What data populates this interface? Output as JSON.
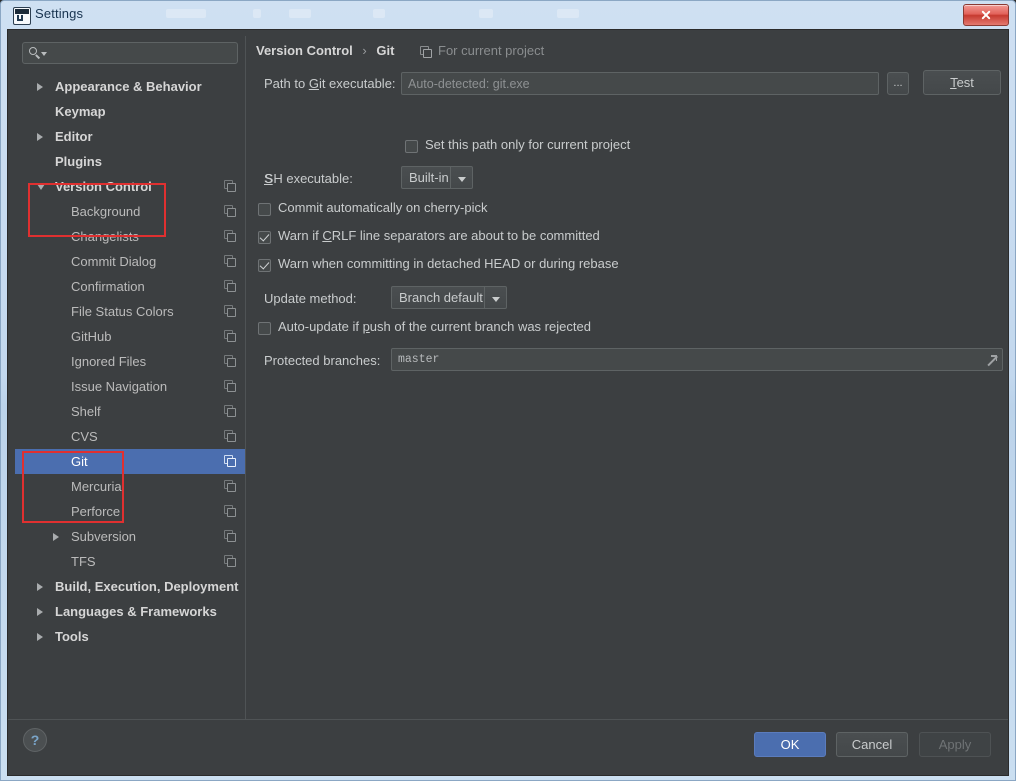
{
  "window": {
    "title": "Settings",
    "app_icon": "intellij-idea-icon",
    "close_label": "Close"
  },
  "search": {
    "value": "",
    "placeholder": "",
    "icon": "search-icon",
    "dropdown_icon": "chevron-down-icon"
  },
  "sidebar": {
    "items": [
      {
        "label": "Appearance & Behavior",
        "indent": 40,
        "arrow": "closed",
        "bold": true,
        "scope_icon": false,
        "selected": false
      },
      {
        "label": "Keymap",
        "indent": 40,
        "arrow": "none",
        "bold": true,
        "scope_icon": false,
        "selected": false
      },
      {
        "label": "Editor",
        "indent": 40,
        "arrow": "closed",
        "bold": true,
        "scope_icon": false,
        "selected": false
      },
      {
        "label": "Plugins",
        "indent": 40,
        "arrow": "none",
        "bold": true,
        "scope_icon": false,
        "selected": false
      },
      {
        "label": "Version Control",
        "indent": 40,
        "arrow": "open",
        "bold": true,
        "scope_icon": true,
        "selected": false
      },
      {
        "label": "Background",
        "indent": 56,
        "arrow": "none",
        "bold": false,
        "scope_icon": true,
        "selected": false
      },
      {
        "label": "Changelists",
        "indent": 56,
        "arrow": "none",
        "bold": false,
        "scope_icon": true,
        "selected": false
      },
      {
        "label": "Commit Dialog",
        "indent": 56,
        "arrow": "none",
        "bold": false,
        "scope_icon": true,
        "selected": false
      },
      {
        "label": "Confirmation",
        "indent": 56,
        "arrow": "none",
        "bold": false,
        "scope_icon": true,
        "selected": false
      },
      {
        "label": "File Status Colors",
        "indent": 56,
        "arrow": "none",
        "bold": false,
        "scope_icon": true,
        "selected": false
      },
      {
        "label": "GitHub",
        "indent": 56,
        "arrow": "none",
        "bold": false,
        "scope_icon": true,
        "selected": false
      },
      {
        "label": "Ignored Files",
        "indent": 56,
        "arrow": "none",
        "bold": false,
        "scope_icon": true,
        "selected": false
      },
      {
        "label": "Issue Navigation",
        "indent": 56,
        "arrow": "none",
        "bold": false,
        "scope_icon": true,
        "selected": false
      },
      {
        "label": "Shelf",
        "indent": 56,
        "arrow": "none",
        "bold": false,
        "scope_icon": true,
        "selected": false
      },
      {
        "label": "CVS",
        "indent": 56,
        "arrow": "none",
        "bold": false,
        "scope_icon": true,
        "selected": false
      },
      {
        "label": "Git",
        "indent": 56,
        "arrow": "none",
        "bold": false,
        "scope_icon": true,
        "selected": true
      },
      {
        "label": "Mercurial",
        "indent": 56,
        "arrow": "none",
        "bold": false,
        "scope_icon": true,
        "selected": false
      },
      {
        "label": "Perforce",
        "indent": 56,
        "arrow": "none",
        "bold": false,
        "scope_icon": true,
        "selected": false
      },
      {
        "label": "Subversion",
        "indent": 56,
        "arrow": "closed",
        "bold": false,
        "scope_icon": true,
        "selected": false
      },
      {
        "label": "TFS",
        "indent": 56,
        "arrow": "none",
        "bold": false,
        "scope_icon": true,
        "selected": false
      },
      {
        "label": "Build, Execution, Deployment",
        "indent": 40,
        "arrow": "closed",
        "bold": true,
        "scope_icon": false,
        "selected": false
      },
      {
        "label": "Languages & Frameworks",
        "indent": 40,
        "arrow": "closed",
        "bold": true,
        "scope_icon": false,
        "selected": false
      },
      {
        "label": "Tools",
        "indent": 40,
        "arrow": "closed",
        "bold": true,
        "scope_icon": false,
        "selected": false
      }
    ],
    "selected_item": "Git",
    "annotations": [
      {
        "name": "annotation-version-control",
        "color": "#e03030"
      },
      {
        "name": "annotation-vcs-providers",
        "color": "#e03030"
      }
    ]
  },
  "main": {
    "breadcrumb": {
      "parent": "Version Control",
      "separator": "›",
      "current": "Git"
    },
    "scope_note": "For current project",
    "scope_note_icon": "project-scope-icon",
    "git_path": {
      "label_before": "Path to ",
      "label_mnemonic": "G",
      "label_after": "it executable:",
      "value": "",
      "placeholder": "Auto-detected: git.exe",
      "browse_label": "...",
      "test_label_mnemonic": "T",
      "test_label_after": "est"
    },
    "set_path_checkbox": {
      "label": "Set this path only for current project",
      "checked": false
    },
    "ssh": {
      "label_mnemonic": "S",
      "label_after": "SH executable:",
      "value": "Built-in"
    },
    "cherry_pick_checkbox": {
      "label": "Commit automatically on cherry-pick",
      "checked": false
    },
    "crlf_checkbox": {
      "before": "Warn if ",
      "mnemonic": "C",
      "after": "RLF line separators are about to be committed",
      "checked": true
    },
    "detached_head_checkbox": {
      "label": "Warn when committing in detached HEAD or during rebase",
      "checked": true
    },
    "update_method": {
      "label": "Update method:",
      "value": "Branch default"
    },
    "auto_update_checkbox": {
      "before": "Auto-update if ",
      "mnemonic": "p",
      "after": "ush of the current branch was rejected",
      "checked": false
    },
    "protected_branches": {
      "label": "Protected branches:",
      "value": "master",
      "expand_icon": "expand-diagonal-icon"
    }
  },
  "footer": {
    "help_label": "?",
    "ok_label": "OK",
    "cancel_label": "Cancel",
    "apply_label": "Apply",
    "apply_disabled": true
  },
  "colors": {
    "background": "#3c3f41",
    "selection": "#4b6eaf",
    "annotation": "#e03030",
    "titlebar": "#c3d8ee"
  }
}
